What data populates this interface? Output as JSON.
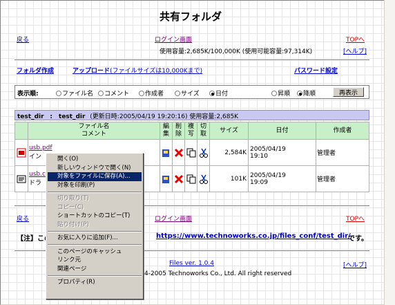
{
  "page_title": "共有フォルダ",
  "nav": {
    "back": "戻る",
    "login": "ログイン画面",
    "top": "TOPへ",
    "help": "[ヘルプ]"
  },
  "usage": "使用容量:2,685K/100,000K (使用可能容量:97,314K)",
  "actions": {
    "create_folder": "フォルダ作成",
    "upload": "アップロード",
    "upload_note": "(ファイルサイズは10,000Kまで)",
    "password": "パスワード設定"
  },
  "sort": {
    "label": "表示順:",
    "options": [
      "ファイル名",
      "コメント",
      "作成者",
      "サイズ",
      "日付"
    ],
    "selected": "日付",
    "order_options": [
      "昇順",
      "降順"
    ],
    "order_selected": "降順",
    "button": "再表示"
  },
  "dir": {
    "name": "test_dir",
    "sep": ":",
    "path": "test_dir",
    "info": "(更新日時:2005/04/19 19:20:16) 使用容量:2,685K"
  },
  "columns": {
    "name": "ファイル名",
    "comment": "コメント",
    "edit": "編集",
    "delete": "削除",
    "copy": "複写",
    "cut": "切取",
    "size": "サイズ",
    "date": "日付",
    "creator": "作成者"
  },
  "rows": [
    {
      "name": "usb.pdf",
      "comment": "イン",
      "size": "2,584K",
      "date": "2005/04/19",
      "time": "19:10",
      "creator": "管理者"
    },
    {
      "name": "usb.c",
      "comment": "ドラ",
      "size": "101K",
      "date": "2005/04/19",
      "time": "19:09",
      "creator": "管理者"
    }
  ],
  "note": {
    "label": "【注】この",
    "url": "https://www.technoworks.co.jp/files_conf/test_dir/",
    "suffix": "です。"
  },
  "footer": {
    "version": "Files ver. 1.0.4",
    "copyright": "4-2005 Technoworks Co., Ltd. All right reserved"
  },
  "context_menu": {
    "open": "開く(O)",
    "open_new_window": "新しいウィンドウで開く(N)",
    "save_target": "対象をファイルに保存(A)...",
    "print_target": "対象を印刷(P)",
    "cut": "切り取り(T)",
    "copy": "コピー(C)",
    "copy_shortcut": "ショートカットのコピー(T)",
    "paste": "貼り付け(P)",
    "add_favorite": "お気に入りに追加(F)...",
    "cache": "このページのキャッシュ",
    "link_source": "リンク元",
    "related_pages": "関連ページ",
    "properties": "プロパティ(R)"
  }
}
